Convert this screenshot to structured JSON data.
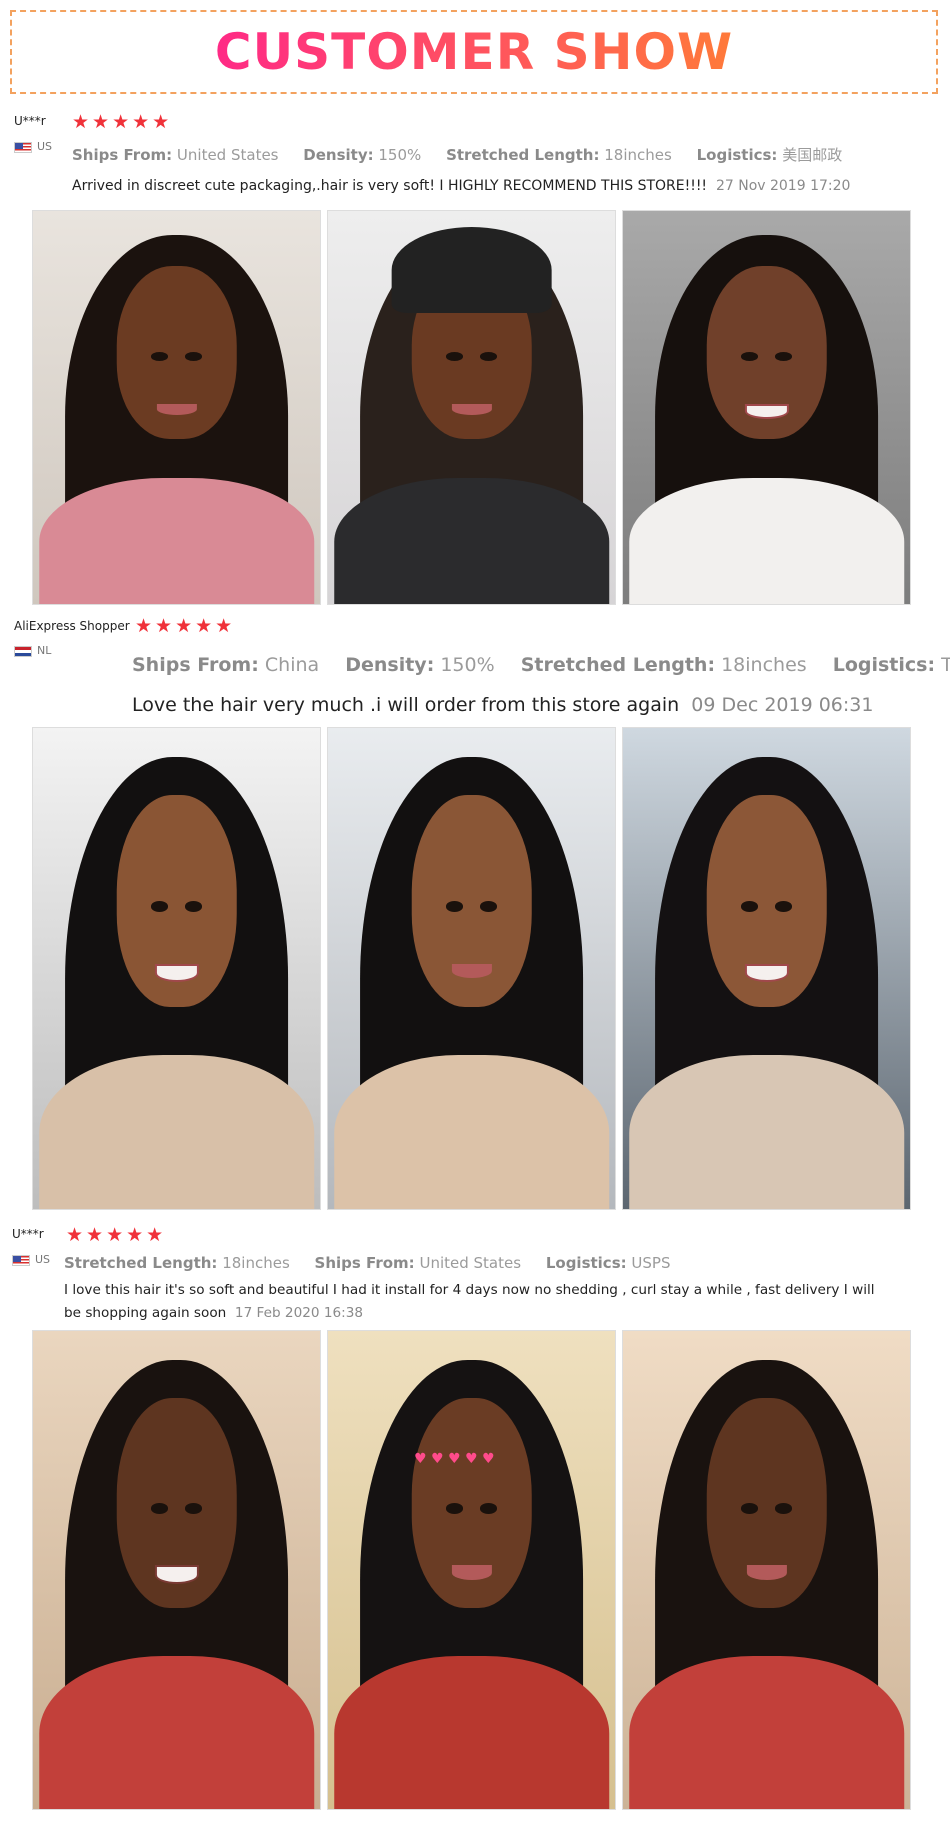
{
  "banner": {
    "title": "CUSTOMER SHOW"
  },
  "reviews": [
    {
      "user": "U***r",
      "country": "US",
      "stars": "★★★★★",
      "attrs": [
        {
          "label": "Ships From:",
          "value": "United States"
        },
        {
          "label": "Density:",
          "value": "150%"
        },
        {
          "label": "Stretched Length:",
          "value": "18inches"
        },
        {
          "label": "Logistics:",
          "value": "美国邮政"
        }
      ],
      "text": "Arrived in discreet cute packaging,.hair is very soft! I HIGHLY RECOMMEND THIS STORE!!!!",
      "date": "27 Nov 2019 17:20",
      "photos": [
        "photo-review1-1",
        "photo-review1-2",
        "photo-review1-3"
      ]
    },
    {
      "user": "AliExpress Shopper",
      "country": "NL",
      "stars": "★★★★★",
      "attrs": [
        {
          "label": "Ships From:",
          "value": "China"
        },
        {
          "label": "Density:",
          "value": "150%"
        },
        {
          "label": "Stretched Length:",
          "value": "18inches"
        },
        {
          "label": "Logistics:",
          "value": "TNT"
        }
      ],
      "text": "Love the hair very much .i will order from this store again",
      "date": "09 Dec 2019 06:31",
      "photos": [
        "photo-review2-1",
        "photo-review2-2",
        "photo-review2-3"
      ]
    },
    {
      "user": "U***r",
      "country": "US",
      "stars": "★★★★★",
      "attrs": [
        {
          "label": "Stretched Length:",
          "value": "18inches"
        },
        {
          "label": "Ships From:",
          "value": "United States"
        },
        {
          "label": "Logistics:",
          "value": "USPS"
        }
      ],
      "text_line1": "I love this hair it's so soft and beautiful I had it install for 4 days now no shedding , curl stay a while , fast delivery I will",
      "text_line2": "be shopping again soon",
      "date": "17 Feb 2020 16:38",
      "photos": [
        "photo-review3-1",
        "photo-review3-2",
        "photo-review3-3"
      ]
    }
  ],
  "colors": {
    "star": "#f0323a",
    "banner_gradient_start": "#ff2a86",
    "banner_gradient_end": "#ff7a3a",
    "border_dash": "#f3a25f"
  }
}
